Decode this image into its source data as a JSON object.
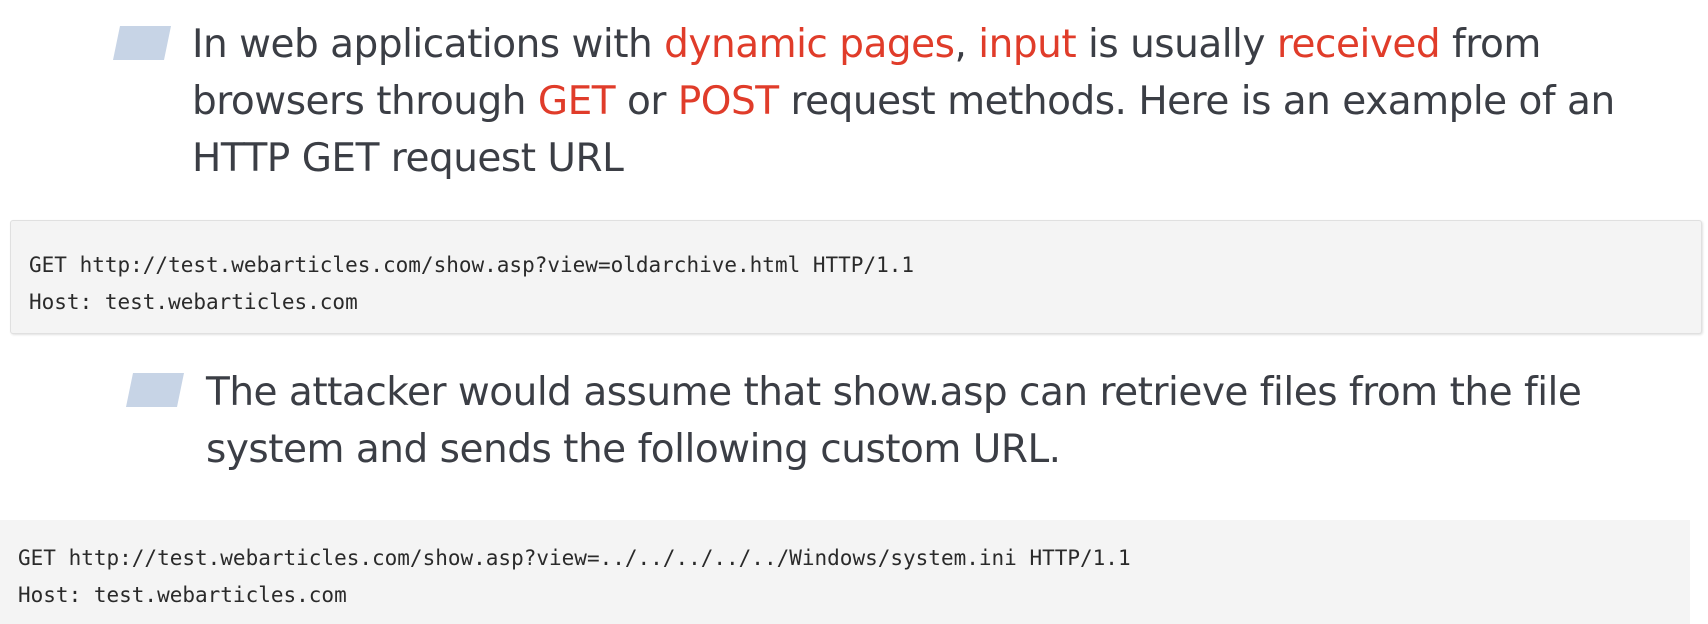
{
  "bullet1": {
    "segments": [
      {
        "text": "In web applications with ",
        "highlight": false
      },
      {
        "text": "dynamic pages",
        "highlight": true
      },
      {
        "text": ", ",
        "highlight": false
      },
      {
        "text": "input",
        "highlight": true
      },
      {
        "text": " is usually ",
        "highlight": false
      },
      {
        "text": "received",
        "highlight": true
      },
      {
        "text": " from browsers through ",
        "highlight": false
      },
      {
        "text": "GET",
        "highlight": true
      },
      {
        "text": " or ",
        "highlight": false
      },
      {
        "text": "POST",
        "highlight": true
      },
      {
        "text": " request methods. Here is an example of an HTTP GET request URL",
        "highlight": false
      }
    ]
  },
  "code1": {
    "lines": [
      "GET http://test.webarticles.com/show.asp?view=oldarchive.html HTTP/1.1",
      "Host: test.webarticles.com"
    ]
  },
  "bullet2": {
    "text": "The attacker would assume that show.asp can retrieve files from the file system and sends the following custom URL."
  },
  "code2": {
    "lines": [
      "GET http://test.webarticles.com/show.asp?view=../../../../../Windows/system.ini HTTP/1.1",
      "Host: test.webarticles.com"
    ]
  },
  "colors": {
    "highlight": "#e03c2a",
    "body_text": "#3b3e45",
    "bullet_marker": "#c7d4e6",
    "code_background": "#f4f4f4"
  }
}
